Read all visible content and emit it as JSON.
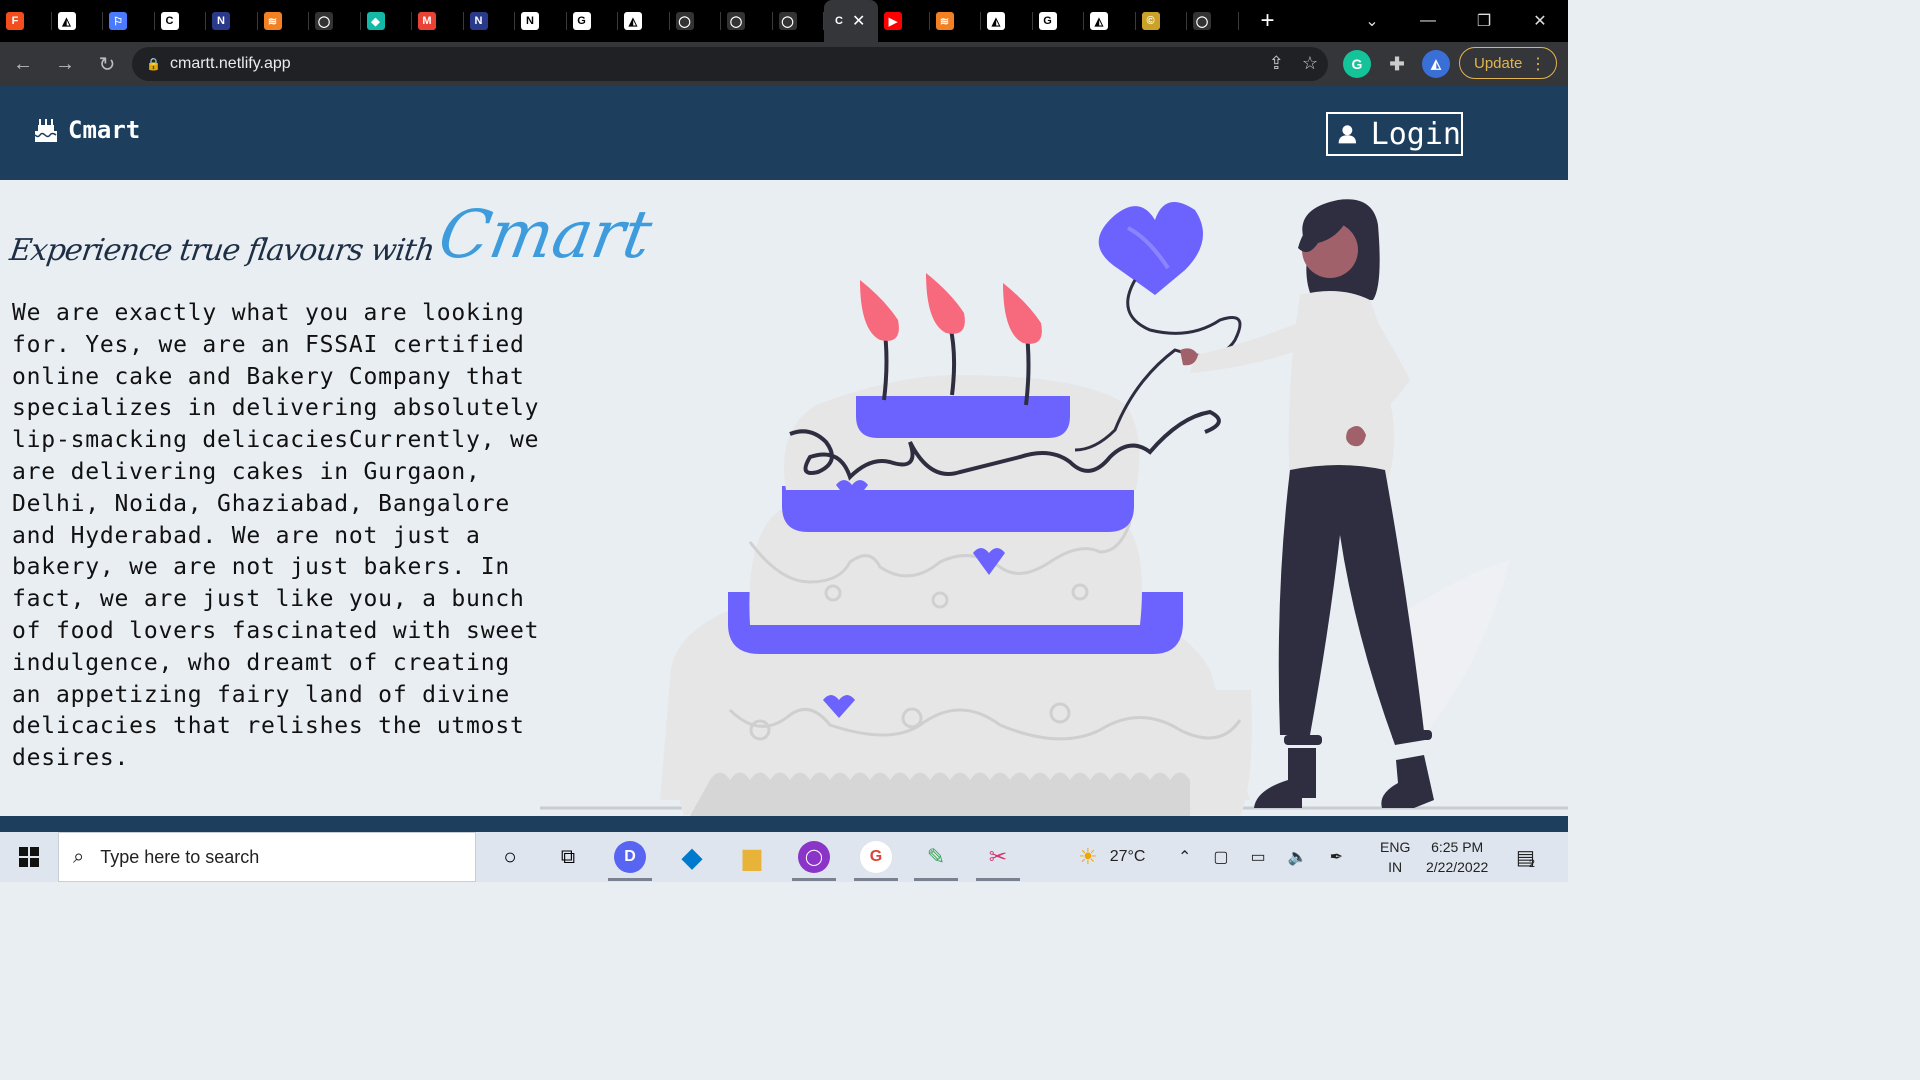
{
  "browser": {
    "tabs": [
      {
        "icon": "figma-icon",
        "color": "#f24e1e",
        "glyph": "F"
      },
      {
        "icon": "doc-icon",
        "color": "#ffffff",
        "glyph": "◭"
      },
      {
        "icon": "flag-icon",
        "color": "#4a7bff",
        "glyph": "⚐"
      },
      {
        "icon": "c-icon",
        "color": "#ffffff",
        "glyph": "C"
      },
      {
        "icon": "neog-icon",
        "color": "#2a3a8a",
        "glyph": "N"
      },
      {
        "icon": "stackoverflow-icon",
        "color": "#f48024",
        "glyph": "≋"
      },
      {
        "icon": "github-icon",
        "color": "#333333",
        "glyph": "◯"
      },
      {
        "icon": "diamond-icon",
        "color": "#14b8a6",
        "glyph": "◆"
      },
      {
        "icon": "gmail-icon",
        "color": "#ea4335",
        "glyph": "M"
      },
      {
        "icon": "neog-icon",
        "color": "#2a3a8a",
        "glyph": "N"
      },
      {
        "icon": "notion-icon",
        "color": "#ffffff",
        "glyph": "N"
      },
      {
        "icon": "google-icon",
        "color": "#ffffff",
        "glyph": "G"
      },
      {
        "icon": "doc-icon",
        "color": "#ffffff",
        "glyph": "◭"
      },
      {
        "icon": "github-icon",
        "color": "#333333",
        "glyph": "◯"
      },
      {
        "icon": "github-icon",
        "color": "#333333",
        "glyph": "◯"
      },
      {
        "icon": "github-icon",
        "color": "#333333",
        "glyph": "◯"
      },
      {
        "icon": "c-icon",
        "color": "#35363a",
        "glyph": "C",
        "active": true
      },
      {
        "icon": "youtube-icon",
        "color": "#ff0000",
        "glyph": "▶"
      },
      {
        "icon": "stackoverflow-icon",
        "color": "#f48024",
        "glyph": "≋"
      },
      {
        "icon": "doc-icon",
        "color": "#ffffff",
        "glyph": "◭"
      },
      {
        "icon": "google-icon",
        "color": "#ffffff",
        "glyph": "G"
      },
      {
        "icon": "doc-icon",
        "color": "#ffffff",
        "glyph": "◭"
      },
      {
        "icon": "copyright-icon",
        "color": "#c9a227",
        "glyph": "©"
      },
      {
        "icon": "github-icon",
        "color": "#333333",
        "glyph": "◯"
      }
    ],
    "url": "cmartt.netlify.app",
    "update_label": "Update"
  },
  "site": {
    "brand_name": "Cmart",
    "login_label": "Login",
    "headline_prefix": "Experience true flavours with",
    "headline_brand": "Cmart",
    "body": "We are exactly what you are looking for. Yes, we are an FSSAI certified online cake and Bakery Company that specializes in delivering absolutely lip-smacking delicaciesCurrently, we are delivering cakes in Gurgaon, Delhi, Noida, Ghaziabad, Bangalore and Hyderabad. We are not just a bakery, we are not just bakers. In fact, we are just like you, a bunch of food lovers fascinated with sweet indulgence, who dreamt of creating an appetizing fairy land of divine delicacies that relishes the utmost desires."
  },
  "taskbar": {
    "search_placeholder": "Type here to search",
    "weather": "27°C",
    "lang_top": "ENG",
    "lang_bottom": "IN",
    "time": "6:25 PM",
    "date": "2/22/2022",
    "notification_count": "2"
  },
  "colors": {
    "header": "#1e3e5e",
    "brand_accent": "#3e9cdc",
    "cake_accent": "#6c63ff",
    "flame": "#f7697d"
  }
}
